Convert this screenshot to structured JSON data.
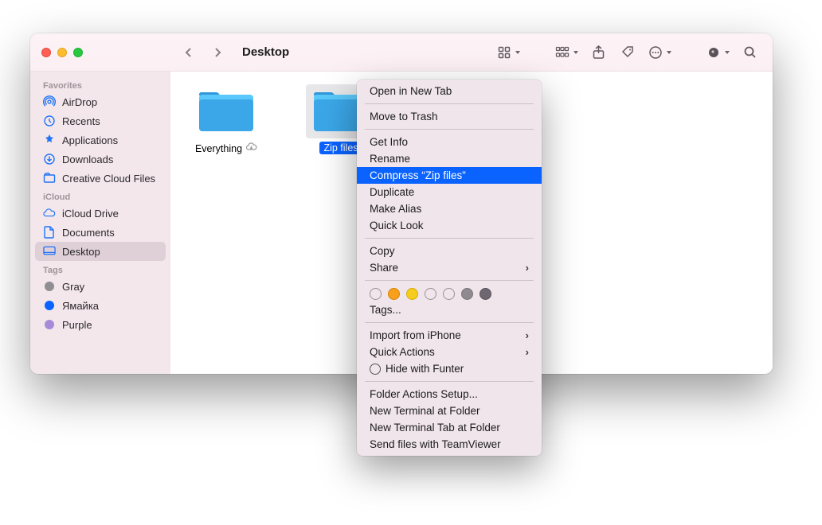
{
  "header": {
    "title": "Desktop"
  },
  "sidebar": {
    "sections": [
      {
        "label": "Favorites",
        "items": [
          {
            "label": "AirDrop"
          },
          {
            "label": "Recents"
          },
          {
            "label": "Applications"
          },
          {
            "label": "Downloads"
          },
          {
            "label": "Creative Cloud Files"
          }
        ]
      },
      {
        "label": "iCloud",
        "items": [
          {
            "label": "iCloud Drive"
          },
          {
            "label": "Documents"
          },
          {
            "label": "Desktop",
            "selected": true
          }
        ]
      },
      {
        "label": "Tags",
        "items": [
          {
            "label": "Gray",
            "color": "#8e8e93"
          },
          {
            "label": "Ямайка",
            "color": "#0a63ff"
          },
          {
            "label": "Purple",
            "color": "#a78ad8"
          }
        ]
      }
    ]
  },
  "folders": [
    {
      "label": "Everything",
      "cloud": true
    },
    {
      "label": "Zip files",
      "selected": true
    }
  ],
  "context": {
    "groups": [
      [
        {
          "label": "Open in New Tab"
        }
      ],
      [
        {
          "label": "Move to Trash"
        }
      ],
      [
        {
          "label": "Get Info"
        },
        {
          "label": "Rename"
        },
        {
          "label": "Compress “Zip files”",
          "highlight": true
        },
        {
          "label": "Duplicate"
        },
        {
          "label": "Make Alias"
        },
        {
          "label": "Quick Look"
        }
      ],
      [
        {
          "label": "Copy"
        },
        {
          "label": "Share",
          "submenu": true
        }
      ],
      [
        {
          "type": "tags"
        },
        {
          "label": "Tags..."
        }
      ],
      [
        {
          "label": "Import from iPhone",
          "submenu": true
        },
        {
          "label": "Quick Actions",
          "submenu": true
        },
        {
          "label": "Hide with Funter",
          "icon": "funter"
        }
      ],
      [
        {
          "label": "Folder Actions Setup..."
        },
        {
          "label": "New Terminal at Folder"
        },
        {
          "label": "New Terminal Tab at Folder"
        },
        {
          "label": "Send files with TeamViewer"
        }
      ]
    ]
  }
}
